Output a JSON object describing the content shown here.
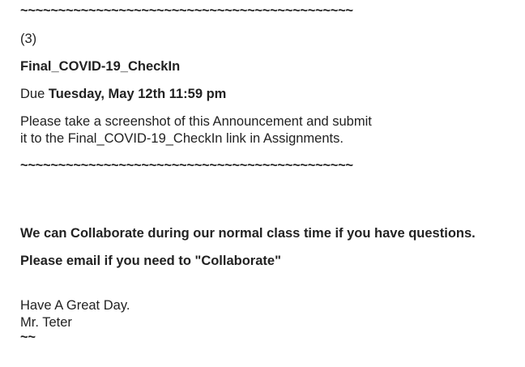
{
  "announcement": {
    "separator_top": "~~~~~~~~~~~~~~~~~~~~~~~~~~~~~~~~~~~~~~~~~~~~",
    "item_number": "(3)",
    "assignment_title": "Final_COVID-19_CheckIn",
    "due_label": "Due",
    "due_date": "Tuesday, May 12th 11:59 pm",
    "instructions_line1": "Please take a screenshot of this Announcement and submit",
    "instructions_line2": "it to the Final_COVID-19_CheckIn link in Assignments.",
    "separator_bottom": "~~~~~~~~~~~~~~~~~~~~~~~~~~~~~~~~~~~~~~~~~~~~",
    "collaborate_note": "We can Collaborate during our normal class time if you have questions.",
    "email_note": "Please email if you need to \"Collaborate\"",
    "closing": "Have A Great Day.",
    "signature": "Mr. Teter",
    "signoff": "~~"
  }
}
